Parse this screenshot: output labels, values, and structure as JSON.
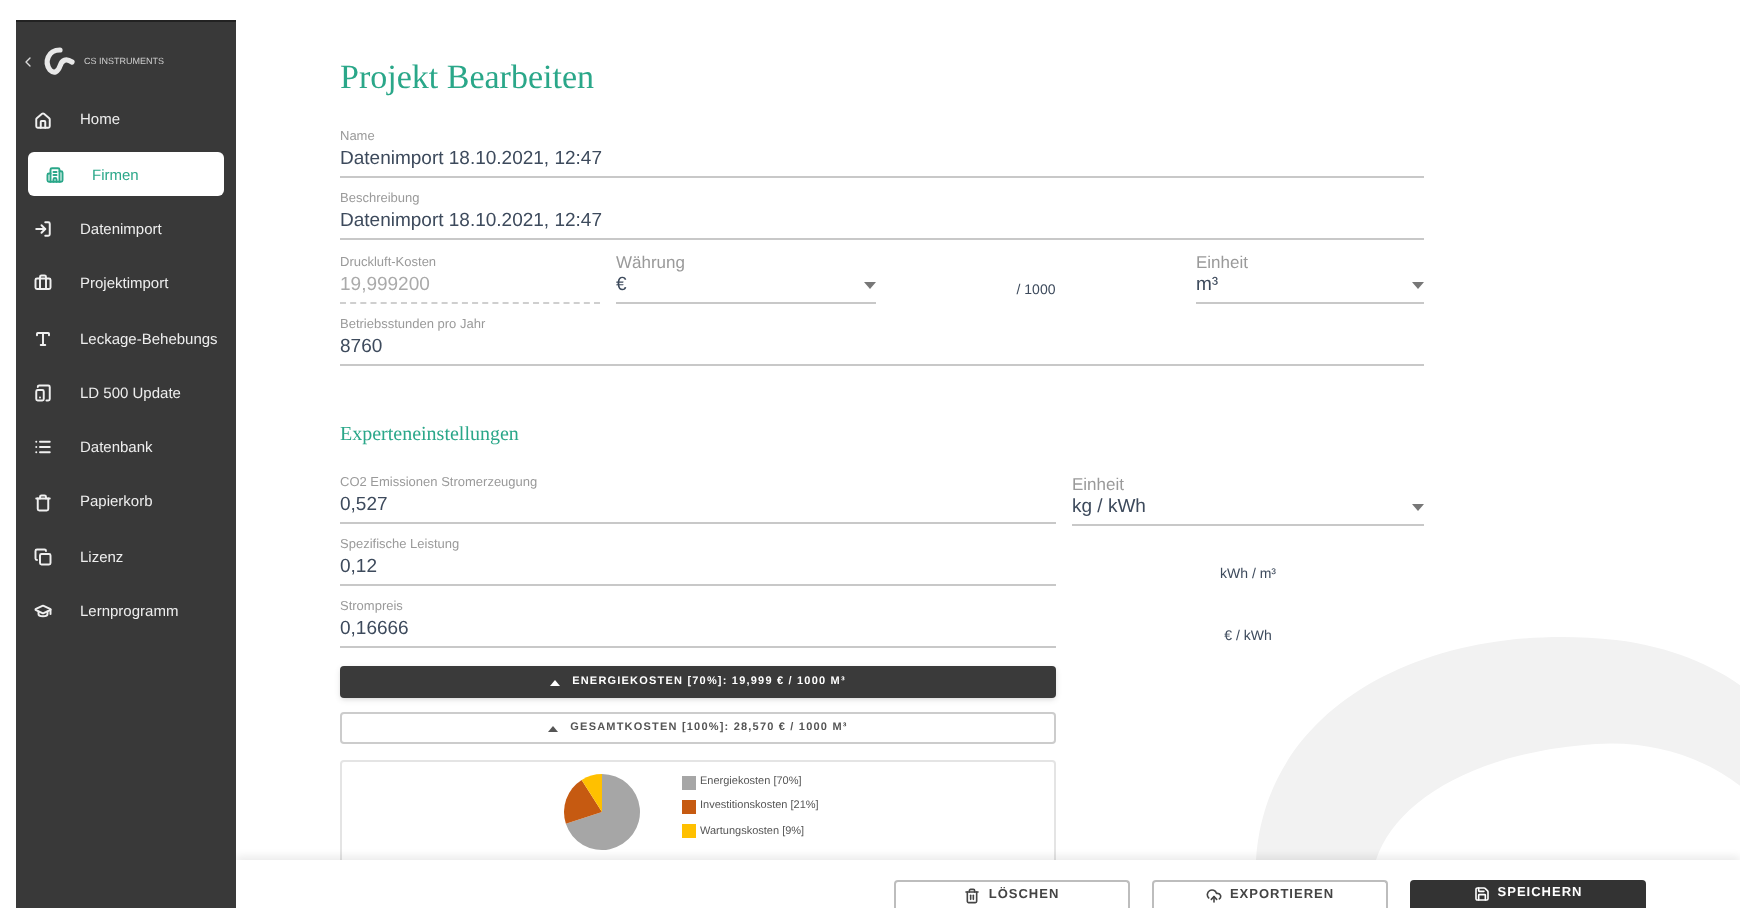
{
  "sidebar": {
    "brand": "CS INSTRUMENTS",
    "items": [
      {
        "label": "Home",
        "selected": false
      },
      {
        "label": "Firmen",
        "selected": true
      },
      {
        "label": "Datenimport",
        "selected": false
      },
      {
        "label": "Projektimport",
        "selected": false
      },
      {
        "label": "Leckage-Behebungs",
        "selected": false
      },
      {
        "label": "LD 500 Update",
        "selected": false
      },
      {
        "label": "Datenbank",
        "selected": false
      },
      {
        "label": "Papierkorb",
        "selected": false
      },
      {
        "label": "Lizenz",
        "selected": false
      },
      {
        "label": "Lernprogramm",
        "selected": false
      }
    ]
  },
  "page_title": "Projekt Bearbeiten",
  "name_field": {
    "label": "Name",
    "value": "Datenimport  18.10.2021, 12:47"
  },
  "description_field": {
    "label": "Beschreibung",
    "value": "Datenimport  18.10.2021, 12:47"
  },
  "cost_field": {
    "label": "Druckluft-Kosten",
    "value": "19,999200",
    "disabled": true
  },
  "currency_select": {
    "label": "Währung",
    "value": "€"
  },
  "per_text": "/ 1000",
  "unit_select": {
    "label": "Einheit",
    "value": "m³"
  },
  "hours_field": {
    "label": "Betriebsstunden pro Jahr",
    "value": "8760"
  },
  "expert_settings": {
    "title": "Experteneinstellungen",
    "fields": [
      {
        "label": "CO2 Emissionen Stromerzeugung",
        "value": "0,527"
      },
      {
        "label": "Spezifische Leistung",
        "value": "0,12"
      },
      {
        "label": "Strompreis",
        "value": "0,16666"
      }
    ],
    "unit_select": {
      "label": "Einheit",
      "value": "kg / kWh"
    },
    "unit_labels": [
      "kWh / m³",
      "€ / kWh"
    ],
    "cost_toggles": [
      {
        "label": "ENERGIEKOSTEN [70%]: 19,999 € / 1000 M³",
        "selected": true
      },
      {
        "label": "GESAMTKOSTEN [100%]: 28,570 € / 1000 M³",
        "selected": false
      }
    ],
    "chart_data": {
      "type": "pie",
      "categories": [
        "Energiekosten [70%]",
        "Investitionskosten [21%]",
        "Wartungskosten [9%]"
      ],
      "values": [
        70,
        21,
        9
      ]
    },
    "legend": [
      {
        "color": "#a6a6a6"
      },
      {
        "color": "#c65a11"
      },
      {
        "color": "#ffc000"
      }
    ]
  },
  "footer_buttons": [
    {
      "kind": "delete",
      "label": "LÖSCHEN"
    },
    {
      "kind": "export",
      "label": "EXPORTIEREN"
    },
    {
      "kind": "save",
      "label": "SPEICHERN"
    }
  ]
}
